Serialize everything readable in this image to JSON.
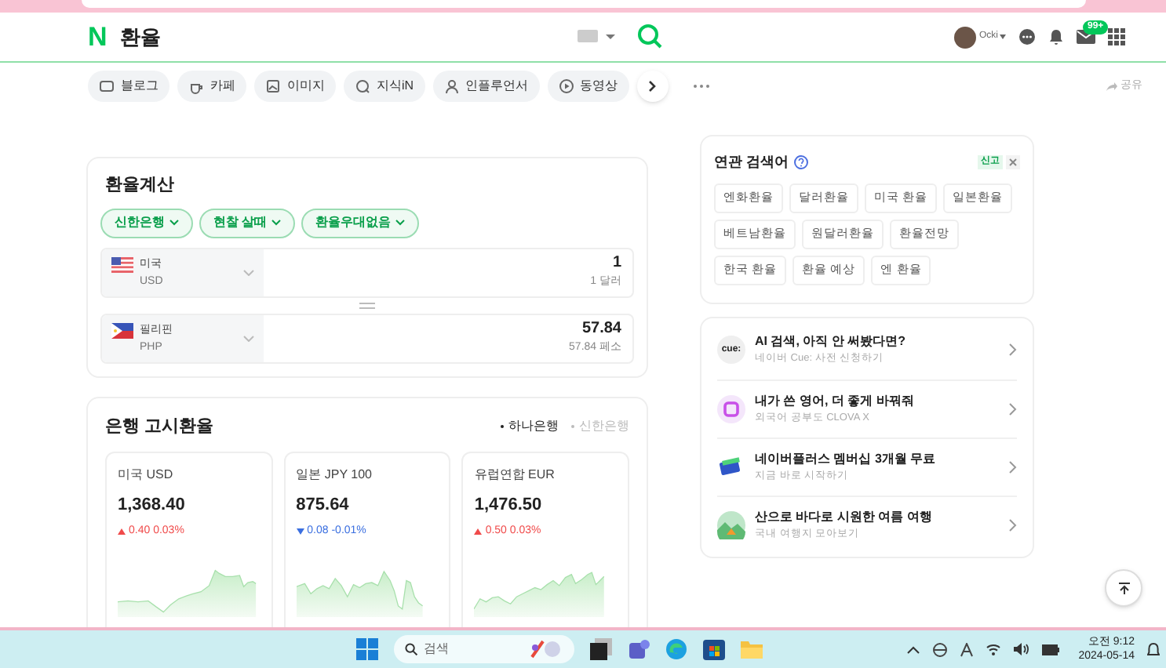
{
  "header": {
    "logo": "N",
    "query": "환율",
    "user": "Ocki",
    "mail_badge": "99+"
  },
  "tabs": [
    {
      "label": "블로그",
      "kind": "blog",
      "selected": false
    },
    {
      "label": "카페",
      "kind": "cafe",
      "selected": false
    },
    {
      "label": "이미지",
      "kind": "image",
      "selected": false
    },
    {
      "label": "지식iN",
      "kind": "qna",
      "selected": false
    },
    {
      "label": "인플루언서",
      "kind": "person",
      "selected": false
    },
    {
      "label": "동영상",
      "kind": "video",
      "selected": false
    }
  ],
  "share": "공유",
  "converter": {
    "title": "환율계산",
    "filters": [
      "신한은행",
      "현찰 살때",
      "환율우대없음"
    ],
    "rows": [
      {
        "kind": "us",
        "country": "미국",
        "code": "USD",
        "amount": "1",
        "amount_text": "1 달러"
      },
      {
        "kind": "ph",
        "country": "필리핀",
        "code": "PHP",
        "amount": "57.84",
        "amount_text": "57.84 페소"
      }
    ]
  },
  "bank_rates": {
    "title": "은행 고시환율",
    "banks": [
      {
        "label": "하나은행",
        "selected": true
      },
      {
        "label": "신한은행",
        "selected": false
      }
    ],
    "cards": [
      {
        "name": "미국 USD",
        "price": "1,368.40",
        "change": "0.40 0.03%",
        "kind": "up"
      },
      {
        "name": "일본 JPY 100",
        "price": "875.64",
        "change": "0.08 -0.01%",
        "kind": "down"
      },
      {
        "name": "유럽연합 EUR",
        "price": "1,476.50",
        "change": "0.50 0.03%",
        "kind": "up"
      }
    ]
  },
  "related": {
    "title": "연관 검색어",
    "report": "신고",
    "keywords": [
      "엔화환율",
      "달러환율",
      "미국 환율",
      "일본환율",
      "베트남환율",
      "원달러환율",
      "환율전망",
      "한국 환율",
      "환율 예상",
      "엔 환율"
    ]
  },
  "promos": [
    {
      "kind": "cue",
      "icon_text": "cue:",
      "title": "AI 검색, 아직 안 써봤다면?",
      "subtitle": "네이버 Cue: 사전 신청하기"
    },
    {
      "kind": "clova",
      "title": "내가 쓴 영어, 더 좋게 바꿔줘",
      "subtitle": "외국어 공부도 CLOVA X"
    },
    {
      "kind": "card",
      "title": "네이버플러스 멤버십 3개월 무료",
      "subtitle": "지금 바로 시작하기"
    },
    {
      "kind": "camp",
      "title": "산으로 바다로 시원한 여름 여행",
      "subtitle": "국내 여행지 모아보기"
    }
  ],
  "taskbar": {
    "search_placeholder": "검색",
    "time": "오전 9:12",
    "date": "2024-05-14"
  }
}
